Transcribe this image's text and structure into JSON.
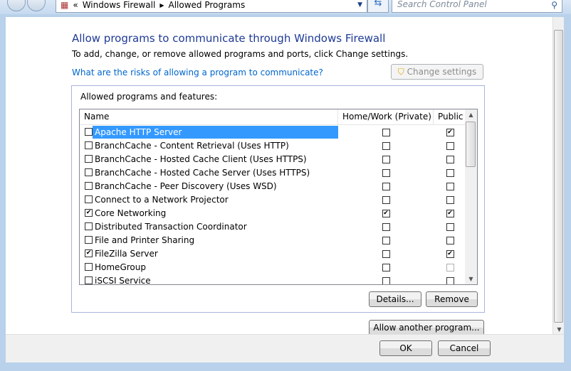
{
  "address": {
    "crumbs": [
      "Windows Firewall",
      "Allowed Programs"
    ],
    "search_placeholder": "Search Control Panel"
  },
  "page": {
    "title": "Allow programs to communicate through Windows Firewall",
    "subtitle": "To add, change, or remove allowed programs and ports, click Change settings.",
    "risk_link": "What are the risks of allowing a program to communicate?",
    "change_settings": "Change settings",
    "group_label": "Allowed programs and features:",
    "columns": [
      "Name",
      "Home/Work (Private)",
      "Public"
    ],
    "rows": [
      {
        "name": "Apache HTTP Server",
        "enabled": false,
        "private": false,
        "public": true,
        "selected": true
      },
      {
        "name": "BranchCache - Content Retrieval (Uses HTTP)",
        "enabled": false,
        "private": false,
        "public": false
      },
      {
        "name": "BranchCache - Hosted Cache Client (Uses HTTPS)",
        "enabled": false,
        "private": false,
        "public": false
      },
      {
        "name": "BranchCache - Hosted Cache Server (Uses HTTPS)",
        "enabled": false,
        "private": false,
        "public": false
      },
      {
        "name": "BranchCache - Peer Discovery (Uses WSD)",
        "enabled": false,
        "private": false,
        "public": false
      },
      {
        "name": "Connect to a Network Projector",
        "enabled": false,
        "private": false,
        "public": false
      },
      {
        "name": "Core Networking",
        "enabled": true,
        "private": true,
        "public": true
      },
      {
        "name": "Distributed Transaction Coordinator",
        "enabled": false,
        "private": false,
        "public": false
      },
      {
        "name": "File and Printer Sharing",
        "enabled": false,
        "private": false,
        "public": false
      },
      {
        "name": "FileZilla Server",
        "enabled": true,
        "private": false,
        "public": true
      },
      {
        "name": "HomeGroup",
        "enabled": false,
        "private": false,
        "public": false,
        "public_disabled": true
      },
      {
        "name": "iSCSI Service",
        "enabled": false,
        "private": false,
        "public": false
      }
    ],
    "details": "Details...",
    "remove": "Remove",
    "allow_another": "Allow another program...",
    "ok": "OK",
    "cancel": "Cancel"
  }
}
